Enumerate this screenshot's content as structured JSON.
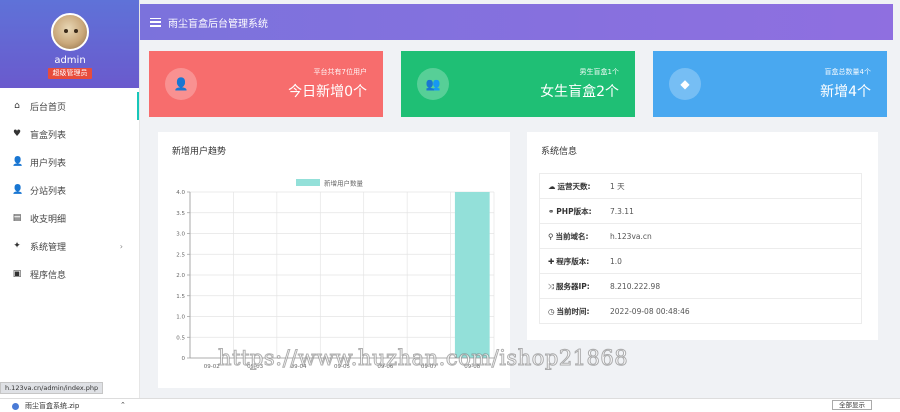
{
  "sidebar": {
    "username": "admin",
    "role": "超级管理员",
    "items": [
      {
        "label": "后台首页",
        "icon": "home-icon",
        "glyph": "⌂"
      },
      {
        "label": "盲盒列表",
        "icon": "heart-icon",
        "glyph": "♥"
      },
      {
        "label": "用户列表",
        "icon": "user-icon",
        "glyph": "👤"
      },
      {
        "label": "分站列表",
        "icon": "user-icon",
        "glyph": "👤"
      },
      {
        "label": "收支明细",
        "icon": "ledger-icon",
        "glyph": "▤"
      },
      {
        "label": "系统管理",
        "icon": "sparkle-icon",
        "glyph": "✦"
      },
      {
        "label": "程序信息",
        "icon": "terminal-icon",
        "glyph": "▣"
      }
    ],
    "submenu_arrow": "›"
  },
  "header": {
    "title": "雨尘盲盒后台管理系统"
  },
  "cards": [
    {
      "sub": "平台共有7位用户",
      "main": "今日新增0个",
      "color": "#f76d6d",
      "icon": "user-add-icon",
      "glyph": "👤"
    },
    {
      "sub": "男生盲盒1个",
      "main": "女生盲盒2个",
      "color": "#1fbf75",
      "icon": "users-icon",
      "glyph": "👥"
    },
    {
      "sub": "盲盒总数量4个",
      "main": "新增4个",
      "color": "#49a8f0",
      "icon": "diamond-icon",
      "glyph": "◆"
    }
  ],
  "chart_panel": {
    "title": "新增用户趋势"
  },
  "chart_data": {
    "type": "bar",
    "legend": "新增用户数量",
    "legend_position": "top",
    "categories": [
      "09-02",
      "09-03",
      "09-04",
      "09-05",
      "09-06",
      "09-07",
      "09-08"
    ],
    "values": [
      0,
      0,
      0,
      0,
      0,
      0,
      4
    ],
    "yticks": [
      "0",
      "0.5",
      "1.0",
      "1.5",
      "2.0",
      "2.5",
      "3.0",
      "3.5",
      "4.0"
    ],
    "ylim": [
      0,
      4
    ],
    "bar_color": "#93e0d9",
    "grid": true
  },
  "system_panel": {
    "title": "系统信息",
    "rows": [
      {
        "icon": "cloud-icon",
        "glyph": "☁",
        "key": "运营天数:",
        "value": "1 天"
      },
      {
        "icon": "link-icon",
        "glyph": "⚭",
        "key": "PHP版本:",
        "value": "7.3.11"
      },
      {
        "icon": "link-icon",
        "glyph": "⚲",
        "key": "当前域名:",
        "value": "h.123va.cn"
      },
      {
        "icon": "android-icon",
        "glyph": "✚",
        "key": "程序版本:",
        "value": "1.0"
      },
      {
        "icon": "shuffle-icon",
        "glyph": "⤨",
        "key": "服务器IP:",
        "value": "8.210.222.98"
      },
      {
        "icon": "clock-icon",
        "glyph": "◷",
        "key": "当前时间:",
        "value": "2022-09-08 00:48:46"
      }
    ]
  },
  "watermark": "https://www.huzhan.com/ishop21868",
  "statusbar": {
    "url": "h.123va.cn/admin/index.php"
  },
  "taskbar": {
    "item": "雨尘盲盒系统.zip",
    "arrow": "⌃",
    "button": "全部显示"
  }
}
